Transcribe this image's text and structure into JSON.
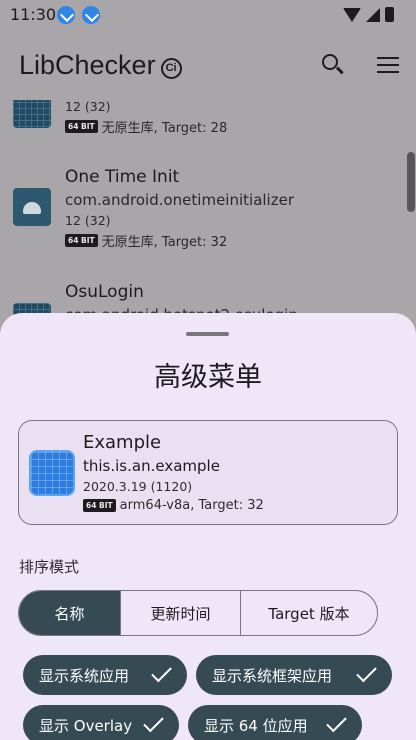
{
  "status_bar": {
    "time": "11:30"
  },
  "toolbar": {
    "title": "LibChecker",
    "title_badge": "Ci"
  },
  "app_list": [
    {
      "name": "",
      "version": "12 (32)",
      "arch": "64 BIT",
      "meta": "无原生库, Target: 28"
    },
    {
      "name": "One Time Init",
      "package": "com.android.onetimeinitializer",
      "version": "12 (32)",
      "arch": "64 BIT",
      "meta": "无原生库, Target: 32"
    },
    {
      "name": "OsuLogin",
      "package": "com.android.hotspot2.osulogin"
    }
  ],
  "sheet": {
    "title": "高级菜单",
    "preview": {
      "name": "Example",
      "package": "this.is.an.example",
      "version": "2020.3.19 (1120)",
      "arch": "64 BIT",
      "meta": "arm64-v8a, Target: 32"
    },
    "sort_label": "排序模式",
    "sort_options": [
      "名称",
      "更新时间",
      "Target 版本"
    ],
    "chips": [
      "显示系统应用",
      "显示系统框架应用",
      "显示 Overlay",
      "显示 64 位应用"
    ]
  },
  "colors": {
    "accent": "#354a53",
    "sheet_bg": "#efe7f8"
  }
}
